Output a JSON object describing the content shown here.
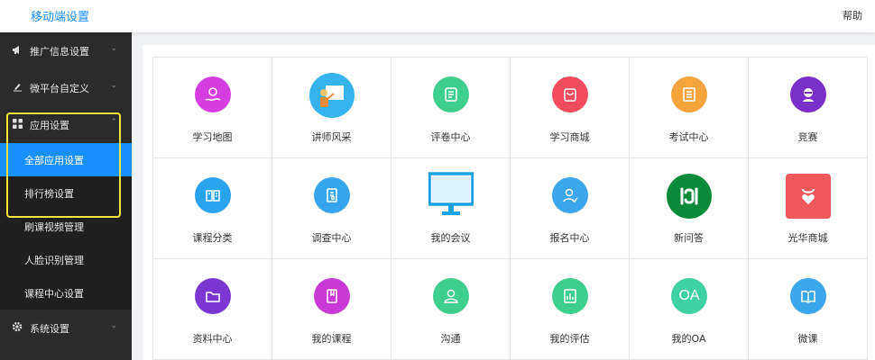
{
  "header": {
    "title": "移动端设置",
    "help": "帮助"
  },
  "sidebar": {
    "groups": [
      {
        "label": "推广信息设置",
        "icon": "megaphone-icon"
      },
      {
        "label": "微平台自定义",
        "icon": "pencil-icon"
      },
      {
        "label": "应用设置",
        "icon": "grid-icon"
      },
      {
        "label": "系统设置",
        "icon": "gear-icon"
      }
    ],
    "sub_items": [
      "全部应用设置",
      "排行榜设置",
      "刷课视频管理",
      "人脸识别管理",
      "课程中心设置"
    ],
    "active": "全部应用设置"
  },
  "apps": [
    {
      "label": "学习地图",
      "icon": "map-icon",
      "color": "#d63de0"
    },
    {
      "label": "讲师风采",
      "icon": "teacher-icon",
      "color": "#35b3ec"
    },
    {
      "label": "评卷中心",
      "icon": "scroll-icon",
      "color": "#3ecf8e"
    },
    {
      "label": "学习商城",
      "icon": "shopping-bag-icon",
      "color": "#f24c5e"
    },
    {
      "label": "考试中心",
      "icon": "exam-icon",
      "color": "#f5a53b"
    },
    {
      "label": "竞赛",
      "icon": "trophy-icon",
      "color": "#7b2fc9"
    },
    {
      "label": "课程分类",
      "icon": "book-icon",
      "color": "#2aa3ef"
    },
    {
      "label": "调查中心",
      "icon": "survey-icon",
      "color": "#35a6ee"
    },
    {
      "label": "我的会议",
      "icon": "monitor-icon",
      "color": "#1aa1e0"
    },
    {
      "label": "报名中心",
      "icon": "user-icon",
      "color": "#3aa6ec"
    },
    {
      "label": "新问答",
      "icon": "qa-icon",
      "color": "#0b8a3c"
    },
    {
      "label": "光华商城",
      "icon": "heart-bag-icon",
      "color": "#ee5a5a"
    },
    {
      "label": "资料中心",
      "icon": "folder-icon",
      "color": "#7b36d2"
    },
    {
      "label": "我的课程",
      "icon": "course-icon",
      "color": "#c839d6"
    },
    {
      "label": "沟通",
      "icon": "person-icon",
      "color": "#3ecf8e"
    },
    {
      "label": "我的评估",
      "icon": "report-icon",
      "color": "#3ecf8e"
    },
    {
      "label": "我的OA",
      "icon": "oa-icon",
      "color": "#3ed1a4",
      "icon_text": "OA"
    },
    {
      "label": "微课",
      "icon": "open-book-icon",
      "color": "#3aa6ec"
    }
  ]
}
